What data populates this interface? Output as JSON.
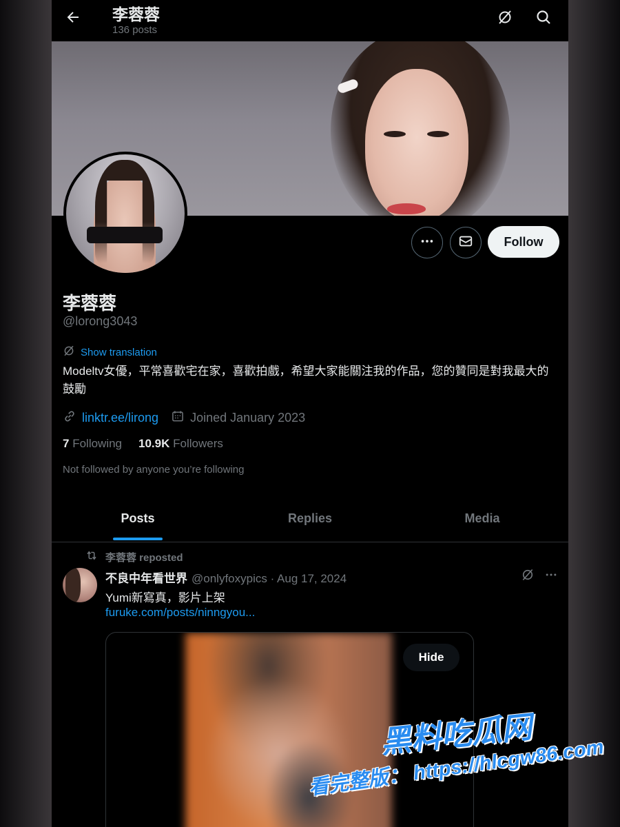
{
  "topbar": {
    "name": "李蓉蓉",
    "posts": "136 posts",
    "icons": [
      "back-arrow-icon",
      "grok-icon",
      "search-icon"
    ]
  },
  "profile": {
    "display_name": "李蓉蓉",
    "handle": "@lorong3043",
    "show_translation": "Show translation",
    "bio": "Modeltv女優，平常喜歡宅在家，喜歡拍戲，希望大家能關注我的作品，您的贊同是對我最大的鼓勵",
    "link": "linktr.ee/lirong",
    "joined": "Joined January 2023",
    "following_count": "7",
    "following_label": "Following",
    "followers_count": "10.9K",
    "followers_label": "Followers",
    "not_followed": "Not followed by anyone you’re following",
    "follow_label": "Follow"
  },
  "tabs": [
    {
      "label": "Posts",
      "active": true
    },
    {
      "label": "Replies",
      "active": false
    },
    {
      "label": "Media",
      "active": false
    }
  ],
  "post": {
    "repost_label": "李蓉蓉 reposted",
    "author": "不良中年看世界",
    "handle_date": "@onlyfoxypics · Aug 17, 2024",
    "text": "Yumi新寫真，影片上架",
    "link": "furuke.com/posts/ninngyou...",
    "hide_label": "Hide"
  },
  "watermark": {
    "line1": "黑料吃瓜网",
    "line2": "看完整版： https://hlcgw86.com"
  },
  "colors": {
    "accent": "#1d9bf0",
    "background": "#000000",
    "text_primary": "#e7e9ea",
    "text_secondary": "#71767b"
  }
}
